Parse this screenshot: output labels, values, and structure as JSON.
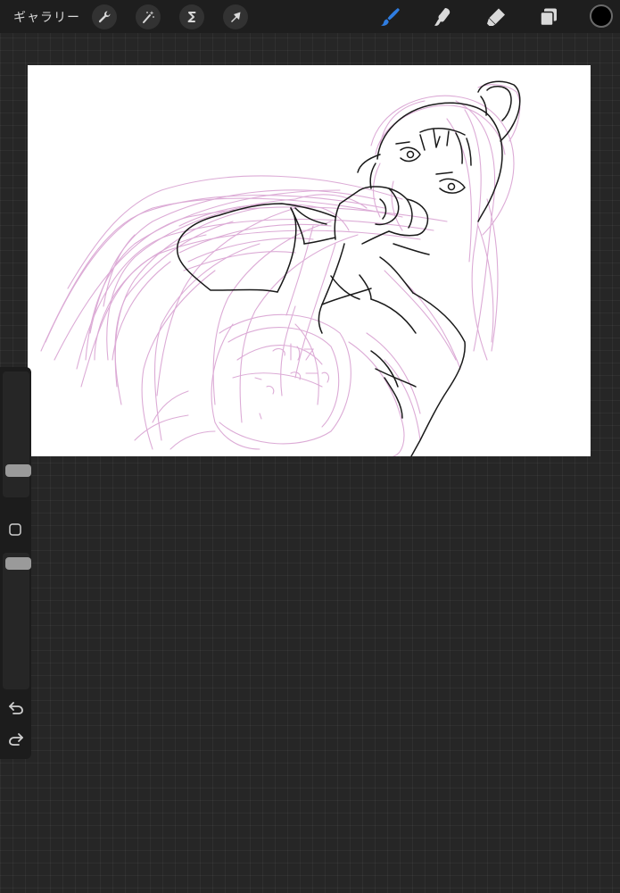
{
  "header": {
    "gallery_label": "ギャラリー",
    "left_tools": [
      {
        "name": "actions",
        "icon": "wrench-icon"
      },
      {
        "name": "adjustments",
        "icon": "magic-wand-icon"
      },
      {
        "name": "selection",
        "icon": "selection-s-icon"
      },
      {
        "name": "transform",
        "icon": "arrow-cursor-icon"
      }
    ],
    "right_tools": [
      {
        "name": "brush",
        "icon": "brush-icon",
        "active": true
      },
      {
        "name": "smudge",
        "icon": "smudge-icon",
        "active": false
      },
      {
        "name": "eraser",
        "icon": "eraser-icon",
        "active": false
      },
      {
        "name": "layers",
        "icon": "layers-icon",
        "active": false
      }
    ],
    "current_color": "#000000"
  },
  "sidebar": {
    "brush_size_level": 0.18,
    "opacity_level": 0.97,
    "tools": [
      {
        "name": "modify",
        "icon": "square-outline-icon"
      },
      {
        "name": "undo",
        "icon": "undo-icon"
      },
      {
        "name": "redo",
        "icon": "redo-icon"
      }
    ]
  },
  "canvas": {
    "background": "#ffffff",
    "sketch_color": "#d9a3d2",
    "line_color": "#1a1a1a"
  },
  "theme": {
    "accent": "#2f7de1",
    "toolbar_bg": "#1e1e1e",
    "workspace_bg": "#262626"
  }
}
